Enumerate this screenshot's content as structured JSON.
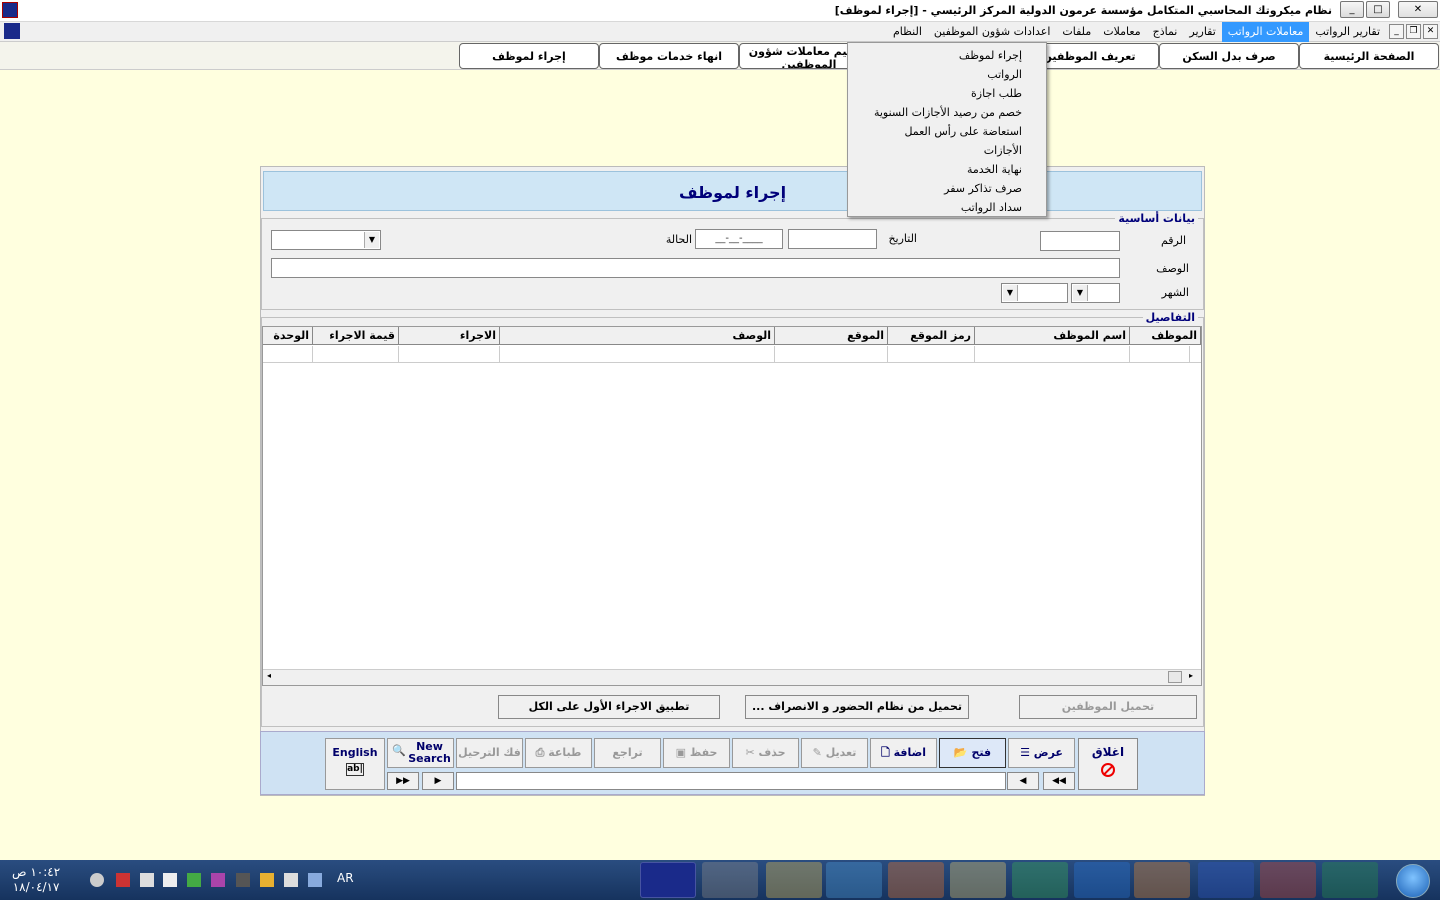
{
  "window": {
    "title": "نظام ميكروتك المحاسبي المتكامل     مؤسسة عرمون الدولية     المركز الرئيسي - [إجراء لموظف]",
    "min": "_",
    "max": "□",
    "close": "✕"
  },
  "menu": {
    "items": [
      "النظام",
      "اعدادات شؤون الموظفين",
      "ملفات",
      "معاملات",
      "نماذج",
      "تقارير",
      "معاملات الرواتب",
      "تقارير الرواتب"
    ],
    "active_index": 6,
    "mdi_min": "_",
    "mdi_restore": "❐",
    "mdi_close": "✕"
  },
  "tabs": [
    "الصفحة الرئيسية",
    "صرف بدل السكن",
    "تعريف الموظفين",
    "تصميم معاملات شؤون الموظفين",
    "انهاء خدمات موظف",
    "إجراء لموظف"
  ],
  "dropdown": {
    "items": [
      "إجراء لموظف",
      "الرواتب",
      "طلب اجازة",
      "خصم من رصيد الأجازات السنوية",
      "استعاضة على رأس العمل",
      "الأجازات",
      "نهاية الخدمة",
      "صرف تذاكر سفر",
      "سداد الرواتب"
    ]
  },
  "form": {
    "title": "إجراء لموظف",
    "basic_group": "بيانات أساسية",
    "label_number": "الرقم",
    "label_date": "التاريخ",
    "date_mask": "__-__-____",
    "label_status": "الحالة",
    "label_description": "الوصف",
    "label_month": "الشهر",
    "details_group": "التفاصيل",
    "grid_headers": [
      "الموظف",
      "اسم الموظف",
      "رمز الموقع",
      "الموقع",
      "الوصف",
      "الاجراء",
      "قيمة الاجراء",
      "الوحدة"
    ],
    "btn_load_employees": "تحميل الموظفين",
    "btn_load_attendance": "تحميل من نظام الحضور و الانصراف ...",
    "btn_apply_first": "تطبيق الاجراء الأول على الكل"
  },
  "toolbar": {
    "close": "اغلاق",
    "view": "عرض",
    "open": "فتح",
    "add": "اضافة",
    "edit": "تعديل",
    "delete": "حذف",
    "save": "حفظ",
    "undo": "تراجع",
    "print": "طباعة",
    "unpost": "فك الترحيل",
    "new_search_1": "New",
    "new_search_2": "Search",
    "english": "English",
    "english_icon": "ab|",
    "nav_first": "◀◀",
    "nav_prev": "◀",
    "nav_next": "▶",
    "nav_last": "▶▶"
  },
  "taskbar": {
    "time": "١٠:٤٢ ص",
    "date": "١٨/٠٤/١٧",
    "lang": "AR"
  }
}
